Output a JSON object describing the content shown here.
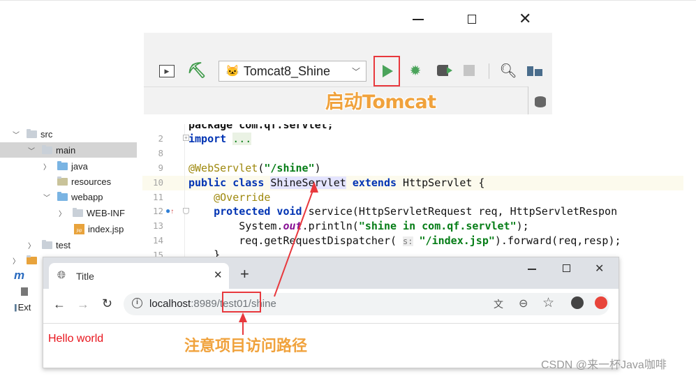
{
  "ide_toolbar": {
    "run_config": "Tomcat8_Shine",
    "annotation_start": "启动Tomcat"
  },
  "project_tree": {
    "items": [
      {
        "label": "src"
      },
      {
        "label": "main"
      },
      {
        "label": "java"
      },
      {
        "label": "resources"
      },
      {
        "label": "webapp"
      },
      {
        "label": "WEB-INF"
      },
      {
        "label": "index.jsp"
      },
      {
        "label": "test"
      },
      {
        "label": "m"
      },
      {
        "label": "Ext"
      }
    ]
  },
  "editor": {
    "lines": [
      {
        "num": "",
        "text": "package com.qf.servlet;"
      },
      {
        "num": "2",
        "text": "import ..."
      },
      {
        "num": "8",
        "text": ""
      },
      {
        "num": "9",
        "text": "@WebServlet(\"/shine\")"
      },
      {
        "num": "10",
        "text": "public class ShineServlet extends HttpServlet {"
      },
      {
        "num": "11",
        "text": "    @Override"
      },
      {
        "num": "12",
        "text": "    protected void service(HttpServletRequest req, HttpServletRespon"
      },
      {
        "num": "13",
        "text": "        System.out.println(\"shine in com.qf.servlet\");"
      },
      {
        "num": "14",
        "text": "        req.getRequestDispatcher( s: \"/index.jsp\").forward(req,resp);"
      },
      {
        "num": "15",
        "text": "    }"
      }
    ]
  },
  "browser": {
    "tab_title": "Title",
    "url_host": "localhost",
    "url_port": ":8989",
    "url_context": "/test01",
    "url_path": "/shine",
    "page_text": "Hello world",
    "annotation_path": "注意项目访问路径"
  },
  "watermark": "CSDN @来一杯Java咖啡",
  "colors": {
    "annotation": "#f0a23c",
    "highlight_box": "#e8383d",
    "run_green": "#4aa35a"
  }
}
